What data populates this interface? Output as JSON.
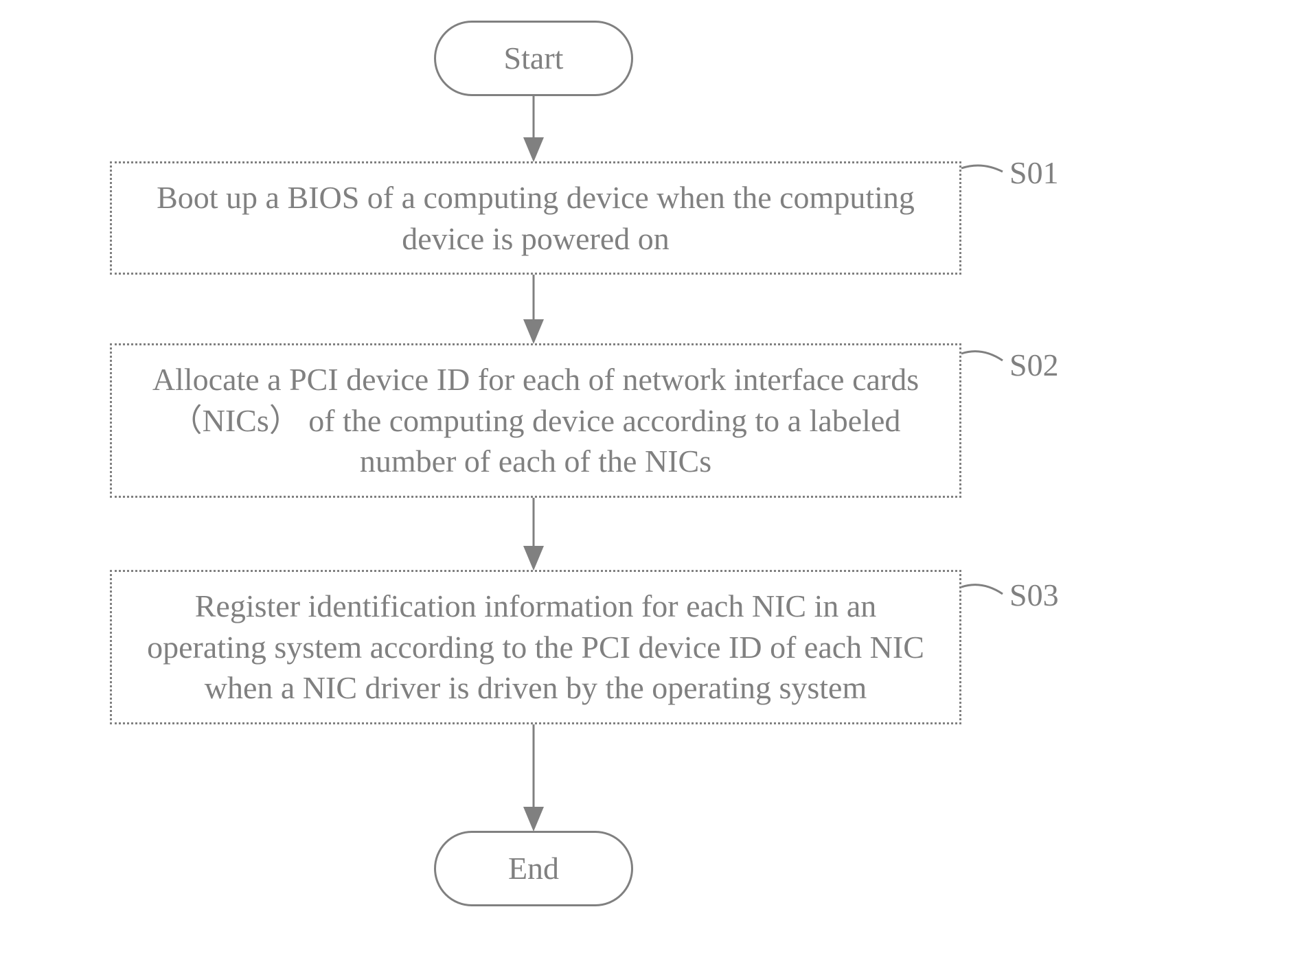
{
  "flow": {
    "start": "Start",
    "step1": "Boot up a BIOS of a computing device when the computing device is powered on",
    "step2": "Allocate a PCI device ID for each of network interface cards （NICs） of the computing device according to a labeled number of each of the NICs",
    "step3": "Register identification information for each NIC in an operating system according to the PCI device ID of each NIC when a NIC driver is driven by the operating system",
    "end": "End"
  },
  "labels": {
    "s1": "S01",
    "s2": "S02",
    "s3": "S03"
  }
}
